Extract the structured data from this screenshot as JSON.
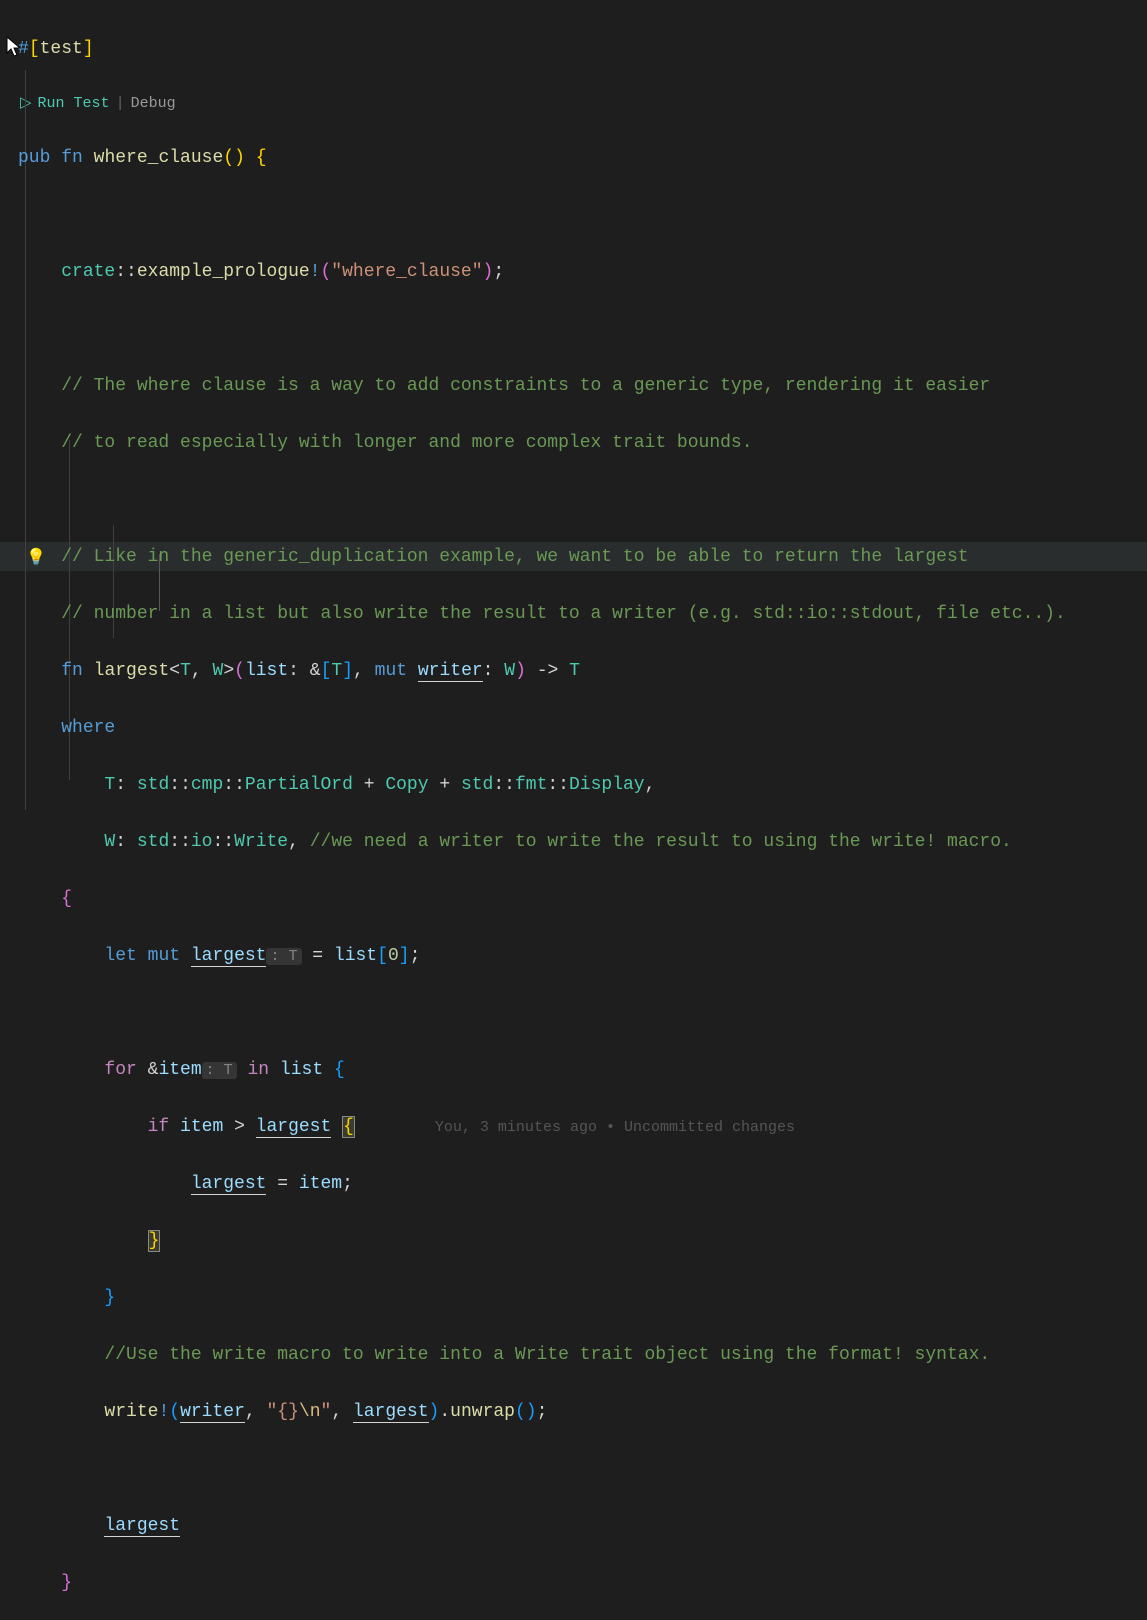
{
  "codelens": {
    "run": "Run Test",
    "debug": "Debug",
    "sep": "|"
  },
  "blame": "You, 3 minutes ago • Uncommitted changes",
  "tokens": {
    "hash": "#",
    "lb": "[",
    "rb": "]",
    "test": "test",
    "pub": "pub",
    "fn": "fn",
    "where_clause": "where_clause",
    "paren": "()",
    "lcurly": "{",
    "rcurly": "}",
    "crate": "crate",
    "dcolon": "::",
    "example_prologue": "example_prologue",
    "bang": "!",
    "str_wc": "\"where_clause\"",
    "semi": ";",
    "c1": "// The where clause is a way to add constraints to a generic type, rendering it easier",
    "c2": "// to read especially with longer and more complex trait bounds.",
    "c3": "// Like in the generic_duplication example, we want to be able to return the largest",
    "c4": "// number in a list but also write the result to a writer (e.g. std::io::stdout, file etc..).",
    "largest_fn": "largest",
    "lt": "<",
    "gt": ">",
    "T": "T",
    "W": "W",
    "comma": ", ",
    "list": "list",
    "colon": ":",
    "amp": "&",
    "mut": "mut",
    "writer": "writer",
    "arrow": " -> ",
    "where": "where",
    "std": "std",
    "cmp": "cmp",
    "PartialOrd": "PartialOrd",
    "plus": " + ",
    "Copy": "Copy",
    "fmt": "fmt",
    "Display": "Display",
    "io": "io",
    "Write": "Write",
    "c5": "//we need a writer to write the result to using the write! macro.",
    "let": "let",
    "largest_var": "largest",
    "eq": " = ",
    "zero": "0",
    "for": "for",
    "item": "item",
    "in": "in",
    "if": "if",
    "gt_op": " > ",
    "c6": "//Use the write macro to write into a Write trait object using the format! syntax.",
    "write": "write",
    "fmtstr_a": "\"{}",
    "fmtstr_esc": "\\n",
    "fmtstr_b": "\"",
    "dot": ".",
    "unwrap": "unwrap",
    "hint_T": ": T"
  }
}
